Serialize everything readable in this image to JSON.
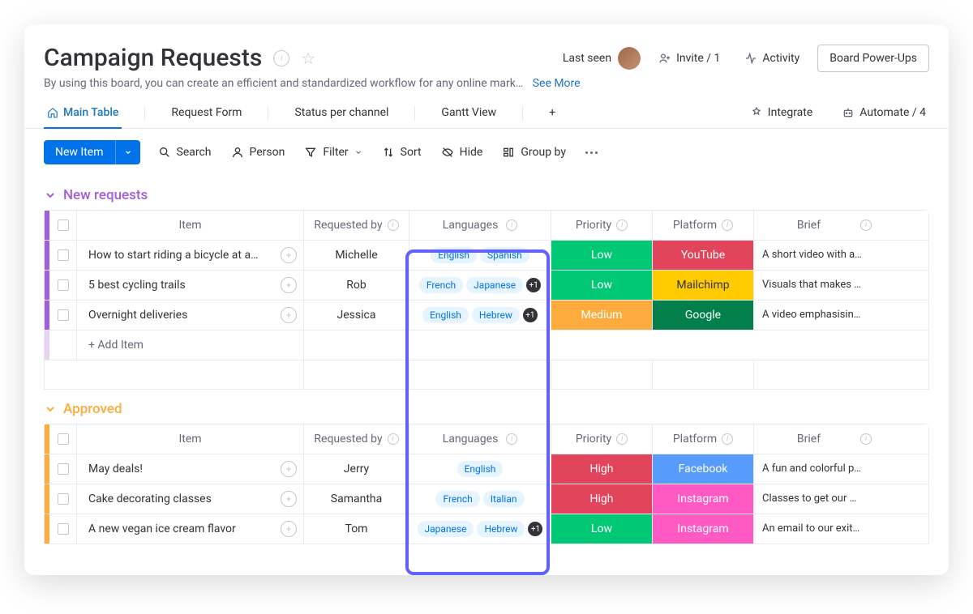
{
  "header": {
    "title": "Campaign Requests",
    "description": "By using this board, you can create an efficient and standardized workflow for any online mark…",
    "see_more": "See More",
    "last_seen": "Last seen",
    "invite": "Invite / 1",
    "activity": "Activity",
    "powerups": "Board Power-Ups"
  },
  "tabs": {
    "main": "Main Table",
    "form": "Request Form",
    "status": "Status per channel",
    "gantt": "Gantt View",
    "add": "+",
    "integrate": "Integrate",
    "automate": "Automate / 4"
  },
  "toolbar": {
    "new_item": "New Item",
    "search": "Search",
    "person": "Person",
    "filter": "Filter",
    "sort": "Sort",
    "hide": "Hide",
    "group": "Group by"
  },
  "columns": {
    "item": "Item",
    "requested": "Requested by",
    "languages": "Languages",
    "priority": "Priority",
    "platform": "Platform",
    "brief": "Brief"
  },
  "groups": [
    {
      "name": "New requests",
      "color": "purple",
      "rows": [
        {
          "item": "How to start riding a bicycle at a…",
          "req": "Michelle",
          "langs": [
            "English",
            "Spanish"
          ],
          "more": 0,
          "pri": "Low",
          "pri_cls": "pill-low",
          "plat": "YouTube",
          "plat_cls": "plat-youtube",
          "brief": "A short video with a…"
        },
        {
          "item": "5 best cycling trails",
          "req": "Rob",
          "langs": [
            "French",
            "Japanese"
          ],
          "more": 1,
          "pri": "Low",
          "pri_cls": "pill-low",
          "plat": "Mailchimp",
          "plat_cls": "plat-mailchimp",
          "brief": "Visuals that makes …"
        },
        {
          "item": "Overnight deliveries",
          "req": "Jessica",
          "langs": [
            "English",
            "Hebrew"
          ],
          "more": 1,
          "pri": "Medium",
          "pri_cls": "pill-med",
          "plat": "Google",
          "plat_cls": "plat-google",
          "brief": "A video emphasisin…"
        }
      ],
      "add": "+ Add Item"
    },
    {
      "name": "Approved",
      "color": "orange",
      "rows": [
        {
          "item": "May deals!",
          "req": "Jerry",
          "langs": [
            "English"
          ],
          "more": 0,
          "pri": "High",
          "pri_cls": "pill-high",
          "plat": "Facebook",
          "plat_cls": "plat-facebook",
          "brief": "A fun and colorful p…"
        },
        {
          "item": "Cake decorating classes",
          "req": "Samantha",
          "langs": [
            "French",
            "Italian"
          ],
          "more": 0,
          "pri": "High",
          "pri_cls": "pill-high",
          "plat": "Instagram",
          "plat_cls": "plat-instagram",
          "brief": "Classes to get our …"
        },
        {
          "item": "A new vegan ice cream flavor",
          "req": "Tom",
          "langs": [
            "Japanese",
            "Hebrew"
          ],
          "more": 1,
          "pri": "Low",
          "pri_cls": "pill-low",
          "plat": "Instagram",
          "plat_cls": "plat-instagram",
          "brief": "An email to our exit…"
        }
      ]
    }
  ]
}
